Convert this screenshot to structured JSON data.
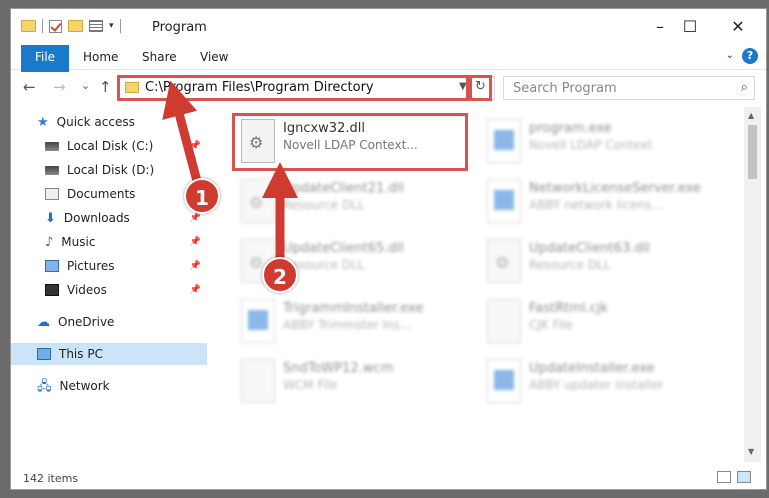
{
  "window": {
    "title": "Program",
    "minimize": "–",
    "maximize": "☐",
    "close": "✕"
  },
  "ribbon": {
    "tabs": [
      "File",
      "Home",
      "Share",
      "View"
    ],
    "help": "?"
  },
  "nav": {
    "back": "←",
    "forward": "→",
    "recent": "⌄",
    "up": "↑",
    "address": "C:\\Program Files\\Program Directory",
    "refresh": "↻",
    "search_placeholder": "Search Program"
  },
  "sidebar": {
    "items": [
      {
        "label": "Quick access",
        "icon": "star-icon"
      },
      {
        "label": "Local Disk (C:)",
        "icon": "drive-icon"
      },
      {
        "label": "Local Disk (D:)",
        "icon": "drive-icon"
      },
      {
        "label": "Documents",
        "icon": "documents-icon"
      },
      {
        "label": "Downloads",
        "icon": "downloads-icon"
      },
      {
        "label": "Music",
        "icon": "music-icon"
      },
      {
        "label": "Pictures",
        "icon": "pictures-icon"
      },
      {
        "label": "Videos",
        "icon": "videos-icon"
      },
      {
        "label": "OneDrive",
        "icon": "cloud-icon"
      },
      {
        "label": "This PC",
        "icon": "computer-icon"
      },
      {
        "label": "Network",
        "icon": "network-icon"
      }
    ]
  },
  "files": [
    {
      "name": "Igncxw32.dll",
      "type": "Novell LDAP Context..."
    },
    {
      "name": "program.exe",
      "type": "Novell LDAP Context"
    },
    {
      "name": "UpdateClient21.dll",
      "type": "Resource DLL"
    },
    {
      "name": "NetworkLicenseServer.exe",
      "type": "ABBY network licens..."
    },
    {
      "name": "UpdateClient65.dll",
      "type": "Resource DLL"
    },
    {
      "name": "UpdateClient63.dll",
      "type": "Resource DLL"
    },
    {
      "name": "TrigrammInstaller.exe",
      "type": "ABBY Trimmster Ins..."
    },
    {
      "name": "FastRtml.cjk",
      "type": "CJK File"
    },
    {
      "name": "SndToWP12.wcm",
      "type": "WCM File"
    },
    {
      "name": "UpdateInstaller.exe",
      "type": "ABBY updater installer"
    }
  ],
  "status": {
    "count": "142 items"
  },
  "annotations": {
    "badge1": "1",
    "badge2": "2"
  },
  "colors": {
    "accent": "#1979ca",
    "highlight": "#d9534f",
    "selected": "#cce4f7"
  }
}
